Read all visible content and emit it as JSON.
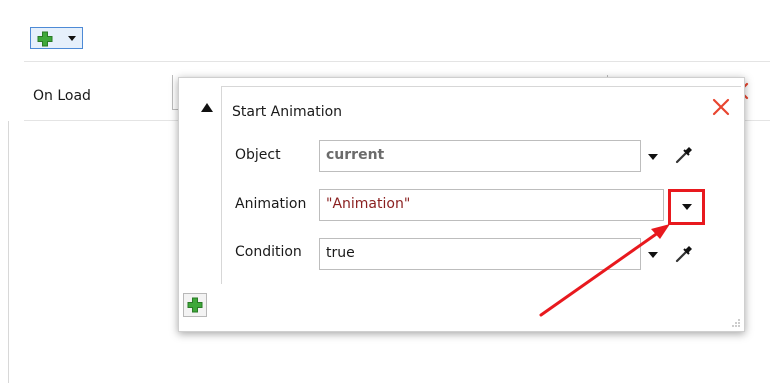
{
  "toolbar": {
    "add_icon": "green-plus-icon",
    "menu_icon": "chevron-down-icon"
  },
  "trigger": {
    "label": "On Load"
  },
  "action": {
    "title": "Start Animation",
    "close_icon": "close-icon",
    "collapse_icon": "triangle-up-icon",
    "rows": {
      "object": {
        "label": "Object",
        "value": "current"
      },
      "animation": {
        "label": "Animation",
        "value": "\"Animation\""
      },
      "condition": {
        "label": "Condition",
        "value": "true"
      }
    },
    "add_icon": "green-plus-icon"
  },
  "colors": {
    "highlight": "#e8191e",
    "close": "#e8452f",
    "plus_green": "#3ea83a"
  }
}
